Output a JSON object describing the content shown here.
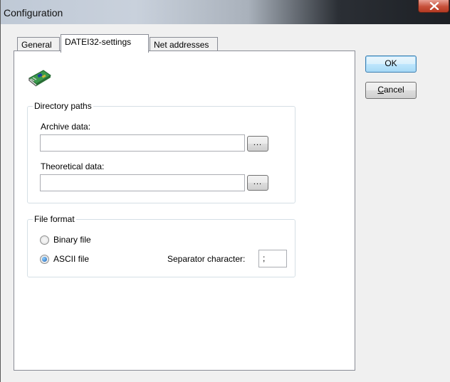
{
  "window": {
    "title": "Configuration"
  },
  "tabs": [
    {
      "label": "General",
      "active": false
    },
    {
      "label": "DATEI32-settings",
      "active": true
    },
    {
      "label": "Net addresses",
      "active": false
    }
  ],
  "directory_paths": {
    "legend": "Directory paths",
    "archive_label": "Archive data:",
    "archive_value": "",
    "theoretical_label": "Theoretical data:",
    "theoretical_value": "",
    "browse_label": "..."
  },
  "file_format": {
    "legend": "File format",
    "binary_label": "Binary file",
    "binary_selected": false,
    "ascii_label": "ASCII file",
    "ascii_selected": true,
    "separator_label": "Separator character:",
    "separator_value": ";"
  },
  "buttons": {
    "ok_label": "OK",
    "cancel_prefix": "C",
    "cancel_rest": "ancel"
  },
  "icons": {
    "close": "close-icon",
    "card": "network-card-icon"
  }
}
